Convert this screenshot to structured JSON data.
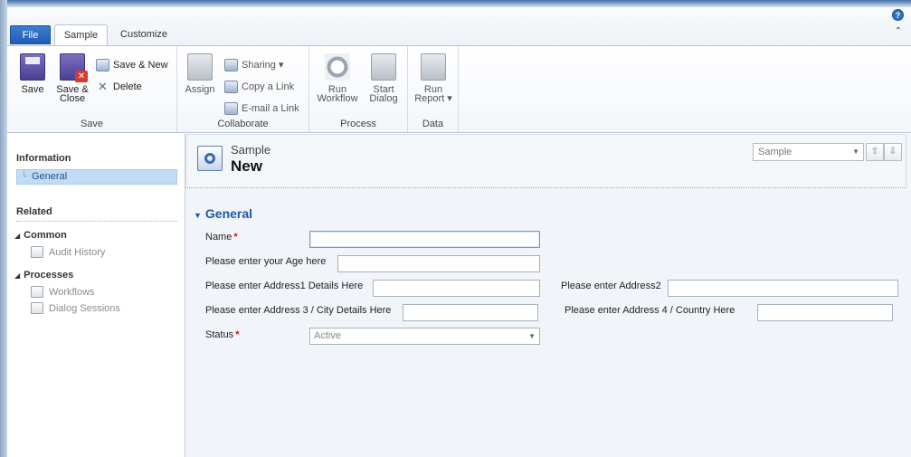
{
  "tabs": {
    "file": "File",
    "sample": "Sample",
    "customize": "Customize"
  },
  "ribbon": {
    "save_group": {
      "label": "Save",
      "save": "Save",
      "save_close_line1": "Save &",
      "save_close_line2": "Close",
      "save_new": "Save & New",
      "delete": "Delete"
    },
    "collaborate_group": {
      "label": "Collaborate",
      "assign": "Assign",
      "sharing": "Sharing",
      "copy_link": "Copy a Link",
      "email_link": "E-mail a Link"
    },
    "process_group": {
      "label": "Process",
      "run_workflow_line1": "Run",
      "run_workflow_line2": "Workflow",
      "start_dialog_line1": "Start",
      "start_dialog_line2": "Dialog"
    },
    "data_group": {
      "label": "Data",
      "run_report_line1": "Run",
      "run_report_line2": "Report"
    },
    "dropdown_arrow": "▾"
  },
  "leftnav": {
    "information": "Information",
    "general": "General",
    "related": "Related",
    "common": "Common",
    "audit_history": "Audit History",
    "processes": "Processes",
    "workflows": "Workflows",
    "dialog_sessions": "Dialog Sessions"
  },
  "form": {
    "entity_name": "Sample",
    "record_name": "New",
    "form_selector": "Sample",
    "section_title": "General",
    "fields": {
      "name_label": "Name",
      "age_label": "Please enter your Age here",
      "address1_label": "Please enter Address1 Details Here",
      "address2_label": "Please enter Address2",
      "address3_label": "Please enter Address 3 / City Details Here",
      "address4_label": "Please enter Address 4 / Country Here",
      "status_label": "Status",
      "status_value": "Active",
      "required_marker": "*"
    }
  },
  "icons": {
    "help": "?",
    "collapse": "⌃",
    "up": "⇧",
    "down": "⇩",
    "triangle_down": "▼",
    "triangle_small": "◢"
  },
  "colors": {
    "accent": "#1d5aa8",
    "file_tab": "#1e5db5",
    "selection": "#c3dcf5",
    "required": "#dd1111"
  }
}
